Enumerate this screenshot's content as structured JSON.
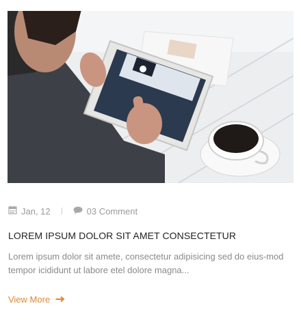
{
  "post": {
    "date": "Jan, 12",
    "comments": "03 Comment",
    "title": "LOREM IPSUM DOLOR SIT AMET CONSECTETUR",
    "excerpt": "Lorem ipsum dolor sit amete, consectetur adipisicing sed do eius-mod tempor icididunt ut labore etel dolore magna...",
    "read_more": "View More"
  },
  "icons": {
    "date": "calendar-icon",
    "comments": "comment-icon",
    "read_more": "arrow-right-icon"
  },
  "colors": {
    "accent": "#e0862f",
    "meta_text": "#9a9a9a",
    "title_text": "#222222",
    "body_text": "#8a8a8a"
  }
}
